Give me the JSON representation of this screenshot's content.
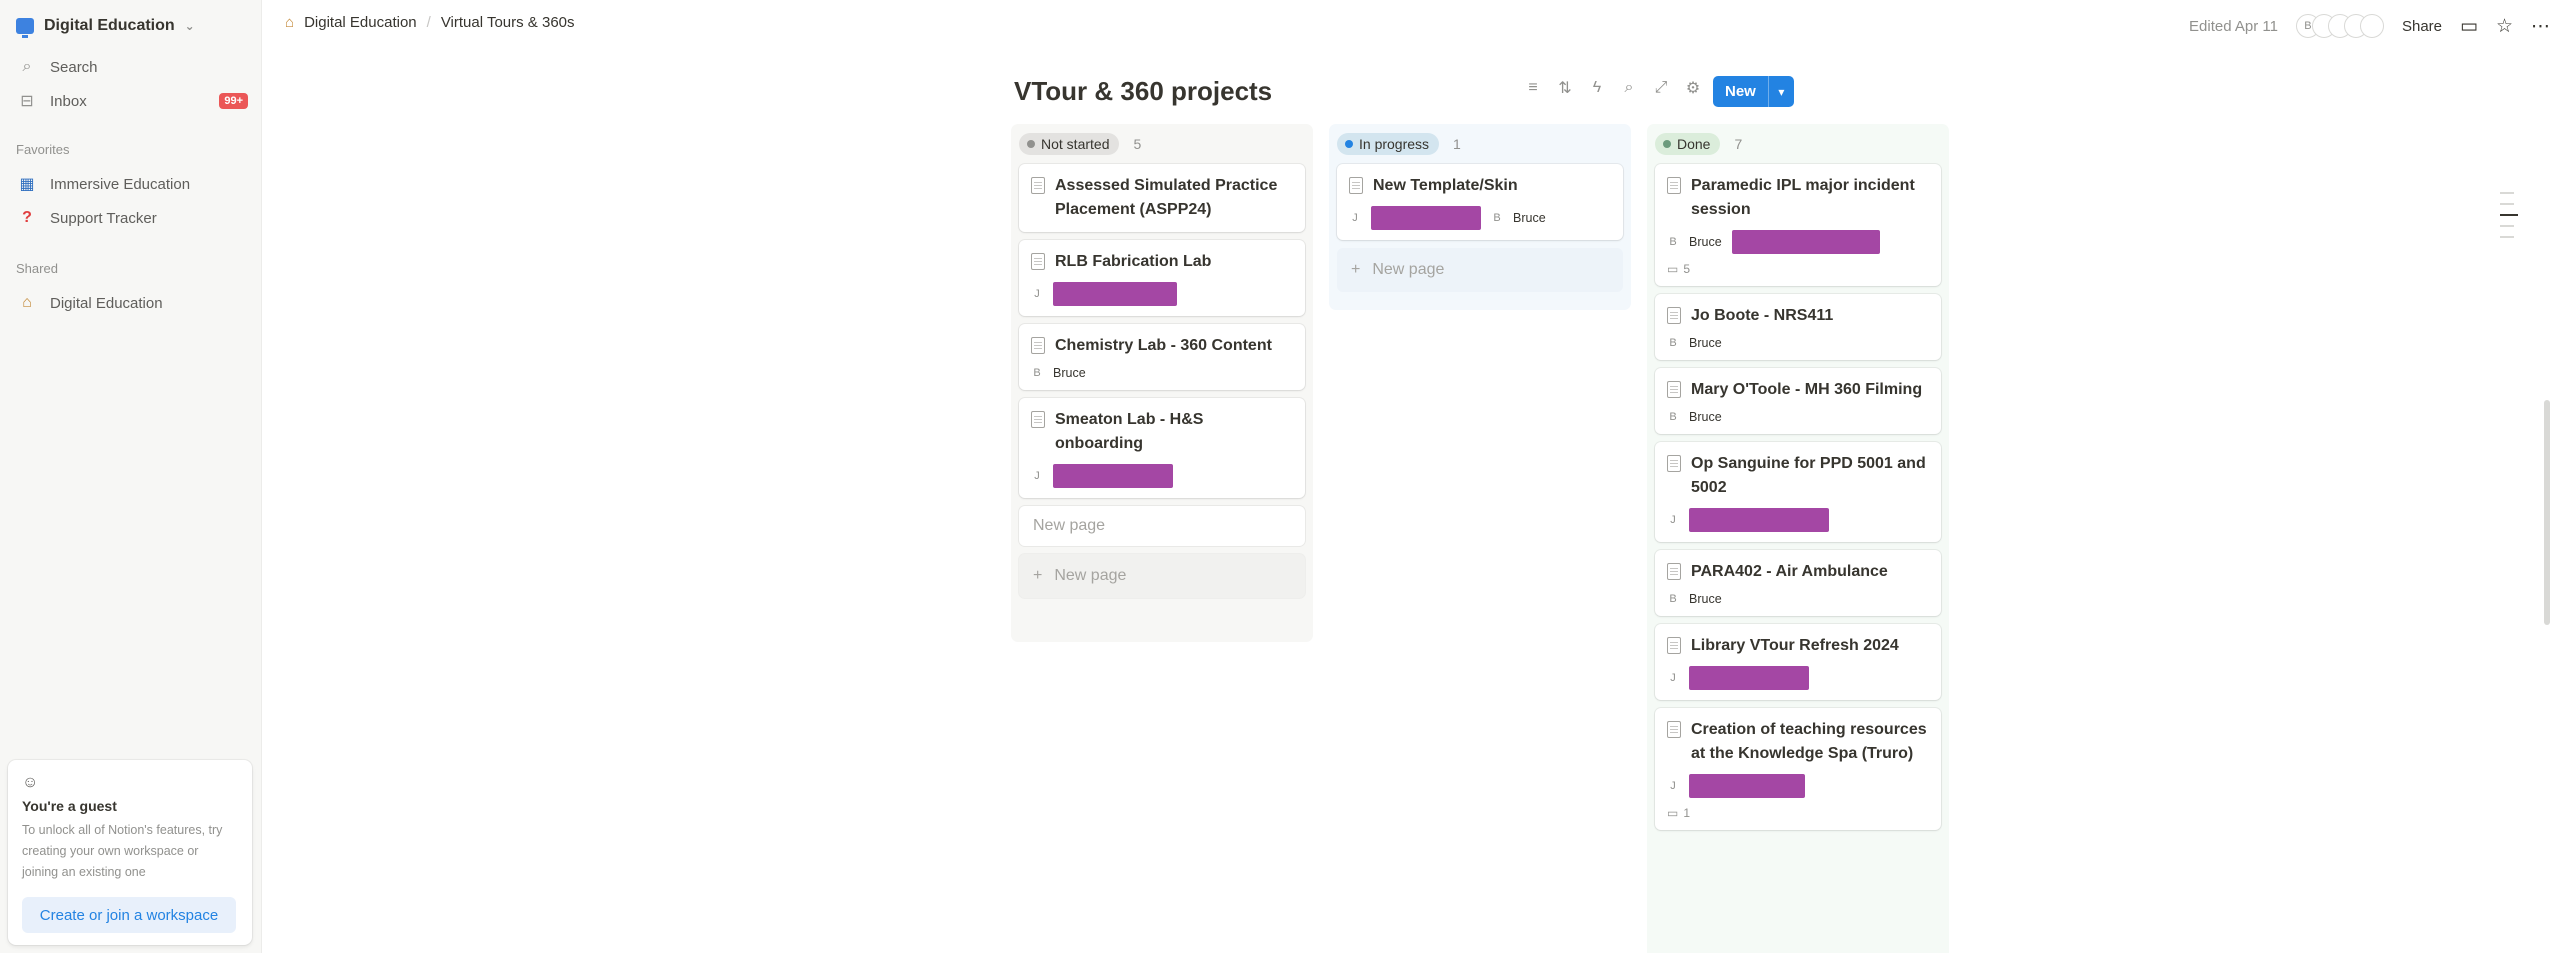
{
  "sidebar": {
    "workspace": "Digital Education",
    "search": "Search",
    "inbox": "Inbox",
    "inbox_badge": "99+",
    "favorites_label": "Favorites",
    "favorites": [
      {
        "label": "Immersive Education",
        "icon": "vr-headset-icon"
      },
      {
        "label": "Support Tracker",
        "icon": "question-mark-icon"
      }
    ],
    "shared_label": "Shared",
    "shared": [
      {
        "label": "Digital Education",
        "icon": "school-icon"
      }
    ],
    "guest": {
      "title": "You're a guest",
      "text": "To unlock all of Notion's features, try creating your own workspace or joining an existing one",
      "button": "Create or join a workspace"
    }
  },
  "topbar": {
    "breadcrumbs": [
      "Digital Education",
      "Virtual Tours & 360s"
    ],
    "edited": "Edited Apr 11",
    "avatars": [
      "B",
      "",
      "",
      "",
      ""
    ],
    "share": "Share"
  },
  "board": {
    "title": "VTour & 360 projects",
    "new_button": "New",
    "new_page_placeholder": "New page",
    "new_page_label": "New page",
    "columns": [
      {
        "name": "Not started",
        "count": "5",
        "pill_bg": "#e3e2e0",
        "dot": "#91918e",
        "cards": [
          {
            "title": "Assessed Simulated Practice Placement (ASPP24)"
          },
          {
            "title": "RLB Fabrication Lab",
            "initial": "J",
            "redacted": true
          },
          {
            "title": "Chemistry Lab - 360 Content",
            "initial": "B",
            "person": "Bruce"
          },
          {
            "title": "Smeaton Lab - H&S onboarding",
            "initial": "J",
            "redacted": true
          }
        ]
      },
      {
        "name": "In progress",
        "count": "1",
        "pill_bg": "#d3e5ef",
        "dot": "#2383e2",
        "cards": [
          {
            "title": "New Template/Skin",
            "initial": "J",
            "redacted": true,
            "initial2": "B",
            "person": "Bruce"
          }
        ]
      },
      {
        "name": "Done",
        "count": "7",
        "pill_bg": "#dbeddb",
        "dot": "#6c9b7d",
        "cards": [
          {
            "title": "Paramedic IPL major incident session",
            "initial": "B",
            "person": "Bruce",
            "redacted_after": true,
            "comments": "5"
          },
          {
            "title": "Jo Boote - NRS411",
            "initial": "B",
            "person": "Bruce"
          },
          {
            "title": "Mary O'Toole - MH 360 Filming",
            "initial": "B",
            "person": "Bruce"
          },
          {
            "title": "Op Sanguine for PPD 5001 and 5002",
            "initial": "J",
            "redacted": true
          },
          {
            "title": "PARA402 - Air Ambulance",
            "initial": "B",
            "person": "Bruce"
          },
          {
            "title": "Library VTour Refresh 2024",
            "initial": "J",
            "redacted": true
          },
          {
            "title": "Creation of teaching resources at the Knowledge Spa (Truro)",
            "initial": "J",
            "redacted": true,
            "comments": "1"
          }
        ]
      }
    ]
  }
}
